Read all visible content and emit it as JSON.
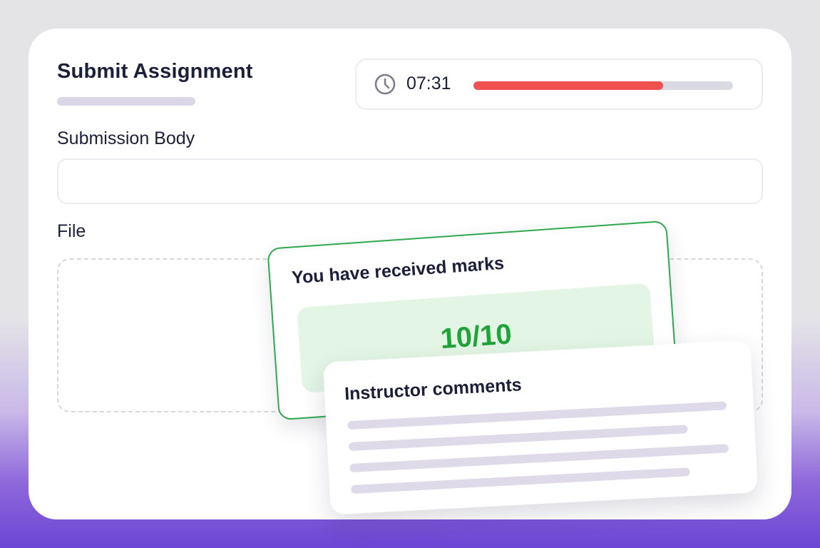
{
  "form": {
    "title": "Submit Assignment",
    "body_label": "Submission Body",
    "body_value": "",
    "file_label": "File"
  },
  "timer": {
    "icon": "clock-icon",
    "time_remaining": "07:31",
    "progress_percent": 73,
    "progress_color": "#f05252"
  },
  "marks": {
    "heading": "You have received marks",
    "score": "10/10",
    "accent_color": "#22a33a"
  },
  "comments": {
    "heading": "Instructor comments"
  }
}
